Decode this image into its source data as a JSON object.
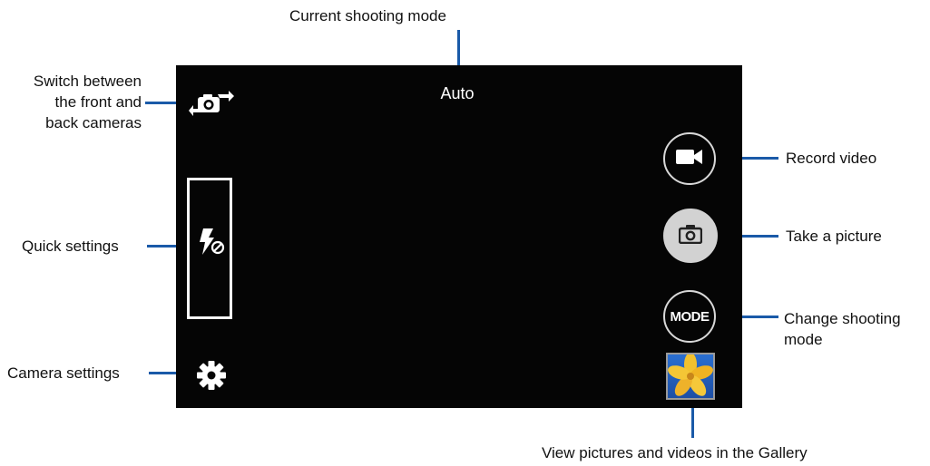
{
  "callouts": {
    "current_mode": "Current shooting mode",
    "switch_camera_line1": "Switch between",
    "switch_camera_line2": "the front and",
    "switch_camera_line3": "back cameras",
    "quick_settings": "Quick settings",
    "camera_settings": "Camera settings",
    "record_video": "Record video",
    "take_picture": "Take a picture",
    "change_mode_line1": "Change shooting",
    "change_mode_line2": "mode",
    "gallery": "View pictures and videos in the Gallery"
  },
  "screen": {
    "shooting_mode": "Auto",
    "mode_button_label": "MODE"
  },
  "icons": {
    "switch_camera": "switch-camera-icon",
    "flash_off": "flash-off-icon",
    "settings": "gear-icon",
    "record_video": "video-camera-icon",
    "shutter": "camera-icon",
    "gallery": "gallery-thumbnail"
  },
  "colors": {
    "callout_line": "#1a5aa8",
    "screen_bg": "#050505"
  }
}
